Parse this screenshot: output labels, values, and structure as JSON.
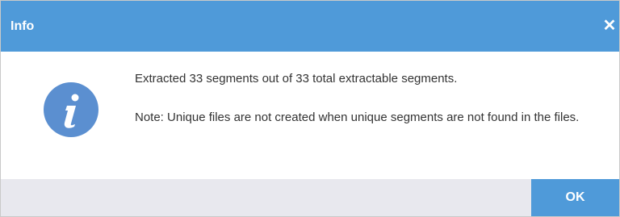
{
  "dialog": {
    "title": "Info",
    "close_glyph": "✕",
    "icon": "info-icon",
    "message_line1": "Extracted 33 segments out of 33 total extractable segments.",
    "message_note": "Note: Unique files are not created when unique segments are not found in the files.",
    "ok_label": "OK"
  },
  "colors": {
    "accent": "#4f9ad9",
    "footer_bg": "#e8e8ee",
    "text": "#333333",
    "icon_bg": "#5b8fd0"
  }
}
